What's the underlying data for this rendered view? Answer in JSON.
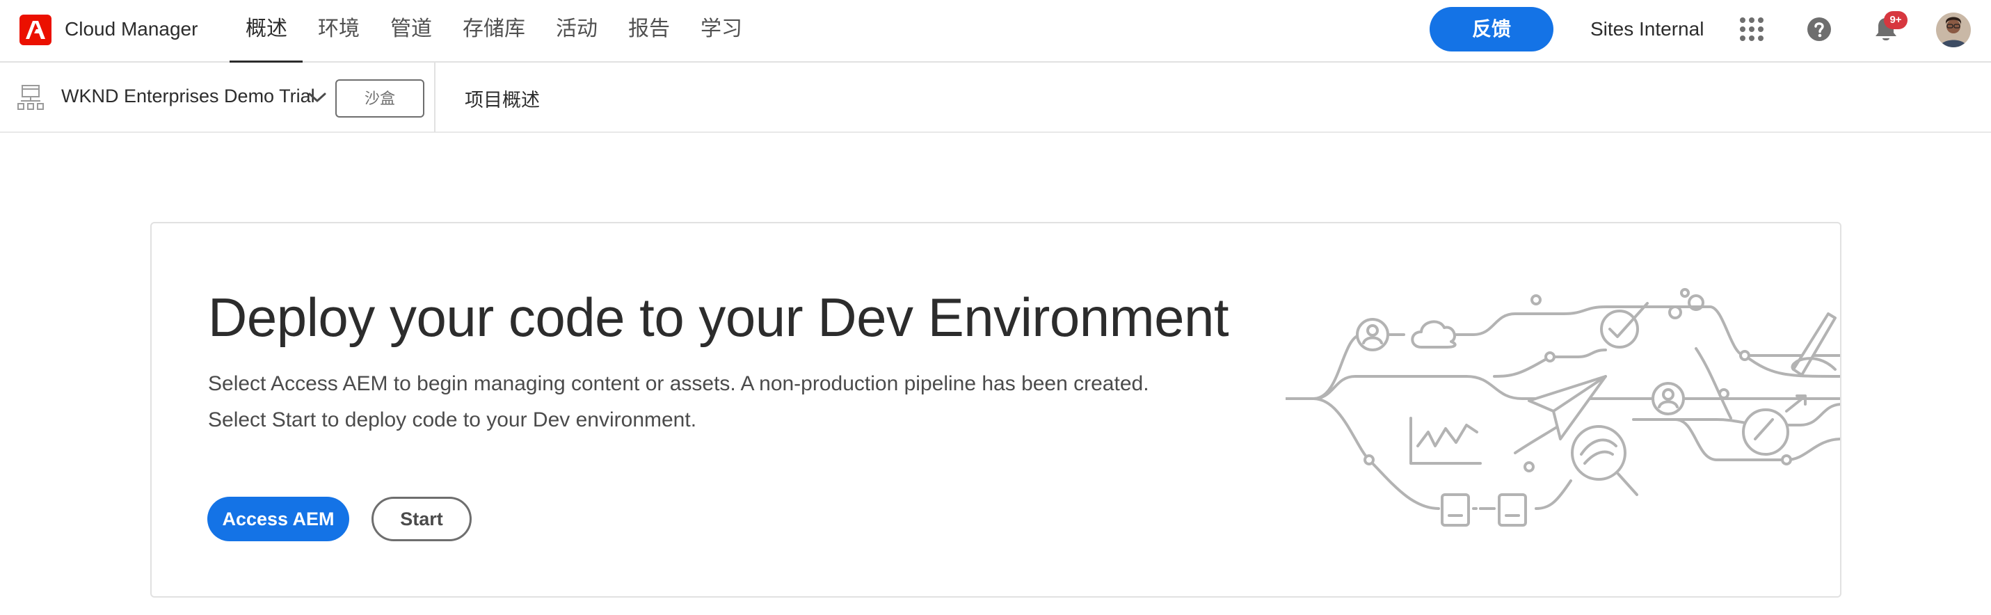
{
  "header": {
    "app_title": "Cloud Manager",
    "tabs": [
      {
        "label": "概述",
        "selected": true
      },
      {
        "label": "环境",
        "selected": false
      },
      {
        "label": "管道",
        "selected": false
      },
      {
        "label": "存储库",
        "selected": false
      },
      {
        "label": "活动",
        "selected": false
      },
      {
        "label": "报告",
        "selected": false
      },
      {
        "label": "学习",
        "selected": false
      }
    ],
    "feedback_label": "反馈",
    "org_name": "Sites Internal",
    "notification_count": "9+",
    "icons": {
      "logo": "adobe-logo",
      "apps": "app-switcher-grid-icon",
      "help": "help-icon",
      "notifications": "bell-icon",
      "profile": "avatar"
    }
  },
  "subbar": {
    "program_name": "WKND Enterprises Demo Trial",
    "program_tag": "沙盒",
    "breadcrumb": "项目概述"
  },
  "hero": {
    "title": "Deploy your code to your Dev Environment",
    "description": "Select Access AEM to begin managing content or assets. A non-production pipeline has been created. Select Start to deploy code to your Dev environment.",
    "primary_button": "Access AEM",
    "secondary_button": "Start"
  },
  "colors": {
    "accent": "#1473e6",
    "brand_red": "#eb1000",
    "badge_red": "#d7373f",
    "text_primary": "#2c2c2c",
    "illustration_gray": "#b3b3b3"
  }
}
